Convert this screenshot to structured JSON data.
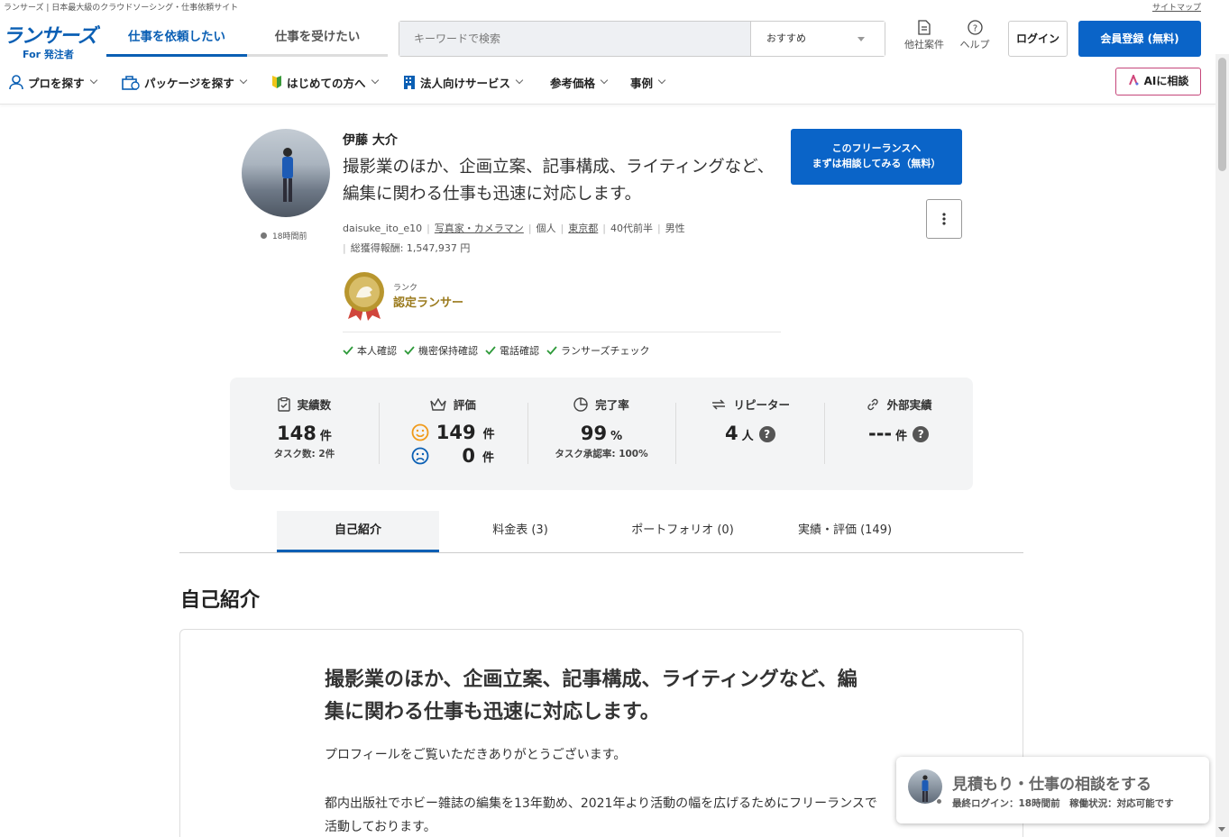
{
  "topbar": {
    "tagline": "ランサーズ | 日本最大級のクラウドソーシング・仕事依頼サイト",
    "sitemap": "サイトマップ"
  },
  "header": {
    "logo": "ランサーズ",
    "logo_sub": "For 発注者",
    "tabs": [
      "仕事を依頼したい",
      "仕事を受けたい"
    ],
    "search_placeholder": "キーワードで検索",
    "sort": "おすすめ",
    "other_jobs": "他社案件",
    "help": "ヘルプ",
    "login": "ログイン",
    "register": "会員登録 (無料)"
  },
  "subnav": {
    "items": [
      "プロを探す",
      "パッケージを探す",
      "はじめての方へ",
      "法人向けサービス",
      "参考価格",
      "事例"
    ],
    "ai_button": "AIに相談"
  },
  "profile": {
    "last_seen": "18時間前",
    "name": "伊藤 大介",
    "tagline": "撮影業のほか、企画立案、記事構成、ライティングなど、編集に関わる仕事も迅速に対応します。",
    "username": "daisuke_ito_e10",
    "occupation": "写真家・カメラマン",
    "type": "個人",
    "location": "東京都",
    "age": "40代前半",
    "gender": "男性",
    "earnings": "総獲得報酬: 1,547,937 円",
    "rank_label": "ランク",
    "rank_value": "認定ランサー",
    "verifications": [
      "本人確認",
      "機密保持確認",
      "電話確認",
      "ランサーズチェック"
    ],
    "consult_line1": "このフリーランスへ",
    "consult_line2": "まずは相談してみる（無料）"
  },
  "stats": {
    "achievements": {
      "label": "実績数",
      "value": "148",
      "unit": "件",
      "note": "タスク数: 2件"
    },
    "rating": {
      "label": "評価",
      "good": "149",
      "bad": "0",
      "unit": "件"
    },
    "completion": {
      "label": "完了率",
      "value": "99",
      "unit": "%",
      "note": "タスク承認率: 100%"
    },
    "repeater": {
      "label": "リピーター",
      "value": "4",
      "unit": "人"
    },
    "external": {
      "label": "外部実績",
      "value": "---",
      "unit": "件"
    }
  },
  "tabs": [
    "自己紹介",
    "料金表 (3)",
    "ポートフォリオ (0)",
    "実績・評価 (149)"
  ],
  "intro": {
    "section_title": "自己紹介",
    "heading": "撮影業のほか、企画立案、記事構成、ライティングなど、編集に関わる仕事も迅速に対応します。",
    "para1": "プロフィールをご覧いただきありがとうございます。",
    "para2": "都内出版社でホビー雑誌の編集を13年勤め、2021年より活動の幅を広げるためにフリーランスで活動しております。"
  },
  "floater": {
    "title": "見積もり・仕事の相談をする",
    "status": "最終ログイン：18時間前　稼働状況：対応可能です"
  },
  "colors": {
    "brand": "#0a5fb4",
    "button": "#0a64c8",
    "rank": "#9b7b1e",
    "check": "#2e9a3a",
    "ai_border": "#c5467a"
  }
}
